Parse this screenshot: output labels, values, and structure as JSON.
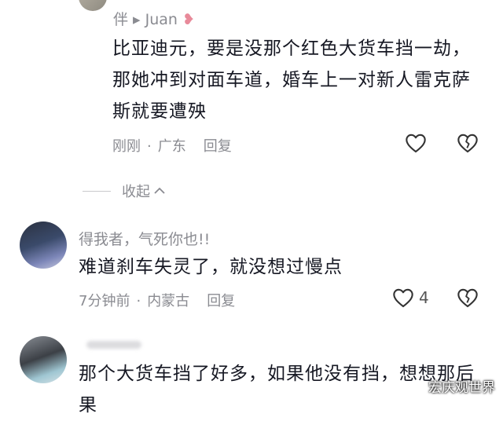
{
  "comments": [
    {
      "author": "伴 ▸ Juan",
      "text_lines": [
        "比亚迪元，要是没那个红色大货车挡一劫，",
        "那她冲到对面车道，婚车上一对新人雷克萨",
        "斯就要遭殃"
      ],
      "time": "刚刚",
      "location": "广东",
      "reply_label": "回复",
      "like_count": ""
    },
    {
      "author": "得我者，气死你也!!",
      "text_lines": [
        "难道刹车失灵了，就没想过慢点"
      ],
      "time": "7分钟前",
      "location": "内蒙古",
      "reply_label": "回复",
      "like_count": "4"
    },
    {
      "author": "",
      "text_lines": [
        "那个大货车挡了好多，如果他没有挡，想想那后",
        "果"
      ]
    }
  ],
  "collapse_label": "收起",
  "watermark": "宏庆观世界",
  "icons": [
    "heart-outline-icon",
    "broken-heart-icon",
    "chevron-up-icon"
  ],
  "colors": {
    "text": "#161823",
    "secondary": "#8a8b91",
    "background": "#ffffff"
  }
}
